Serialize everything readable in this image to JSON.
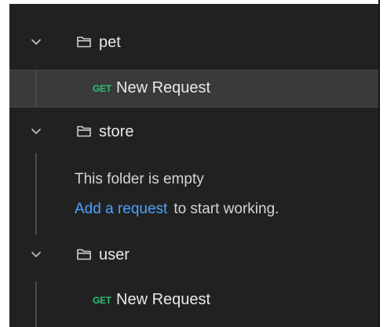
{
  "tree": {
    "folders": [
      {
        "name": "pet"
      },
      {
        "name": "store"
      },
      {
        "name": "user"
      }
    ],
    "requests": [
      {
        "method": "GET",
        "name": "New Request"
      },
      {
        "method": "GET",
        "name": "New Request"
      }
    ],
    "empty_state": {
      "message": "This folder is empty",
      "link_text": "Add a request",
      "suffix": "to start working."
    }
  },
  "colors": {
    "panel_bg": "#212121",
    "selected_bg": "#3a3a3a",
    "get_method": "#2fbf71",
    "link": "#4da3ff",
    "text": "#e8e8e8"
  }
}
